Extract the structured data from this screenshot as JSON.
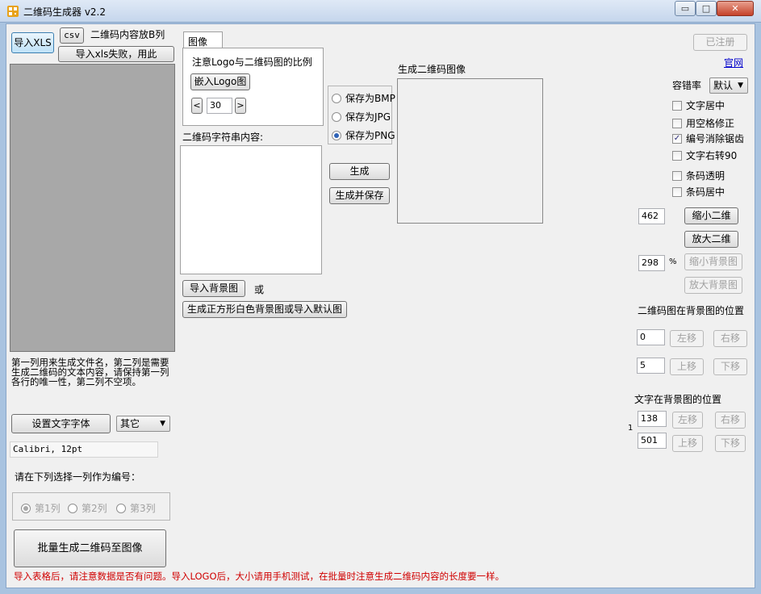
{
  "window": {
    "title": "二维码生成器 v2.2",
    "minimize": "▭",
    "maximize": "□",
    "close": "✕"
  },
  "left": {
    "import_xls": "导入XLS",
    "csv": "csv",
    "content_column_note": "二维码内容放B列",
    "import_fail": "导入xls失败，用此",
    "description": "第一列用来生成文件名，第二列是需要生成二维码的文本内容，请保持第一列各行的唯一性，第二列不空项。",
    "set_font": "设置文字字体",
    "font_select": "其它",
    "font_value": "Calibri, 12pt",
    "select_column_label": "请在下列选择一列作为编号：",
    "columns": [
      "第1列",
      "第2列",
      "第3列"
    ],
    "batch_generate": "批量生成二维码至图像"
  },
  "image_tab": {
    "tab_label": "图像",
    "logo_note": "注意Logo与二维码图的比例",
    "embed_logo": "嵌入Logo图",
    "logo_value": "30",
    "prev": "<",
    "next": ">"
  },
  "save_options": [
    "保存为BMP",
    "保存为JPG",
    "保存为PNG"
  ],
  "center": {
    "content_label": "二维码字符串内容:",
    "generate": "生成",
    "generate_save": "生成并保存",
    "import_bg": "导入背景图",
    "or": "或",
    "gen_white_bg": "生成正方形白色背景图或导入默认图",
    "qr_preview_label": "生成二维码图像"
  },
  "right": {
    "registered": "已注册",
    "official_site": "官网",
    "tolerance_label": "容错率",
    "tolerance_value": "默认",
    "checkboxes": [
      {
        "label": "文字居中",
        "checked": false
      },
      {
        "label": "用空格修正",
        "checked": false
      },
      {
        "label": "编号消除锯齿",
        "checked": true
      },
      {
        "label": "文字右转90",
        "checked": false
      },
      {
        "label": "条码透明",
        "checked": false
      },
      {
        "label": "条码居中",
        "checked": false
      }
    ],
    "qr_size": "462",
    "shrink_qr": "缩小二维",
    "enlarge_qr": "放大二维",
    "bg_percent": "298",
    "percent_sign": "%",
    "shrink_bg": "缩小背景图",
    "enlarge_bg": "放大背景图",
    "qr_pos_label": "二维码图在背景图的位置",
    "qr_x": "0",
    "qr_y": "5",
    "left_move": "左移",
    "right_move": "右移",
    "up_move": "上移",
    "down_move": "下移",
    "text_pos_label": "文字在背景图的位置",
    "text_x": "138",
    "text_y": "501",
    "small_one": "1"
  },
  "footer": {
    "warning": "导入表格后，请注意数据是否有问题。导入LOGO后，大小请用手机测试，在批量时注意生成二维码内容的长度要一样。",
    "warning_color": "#d00000"
  }
}
